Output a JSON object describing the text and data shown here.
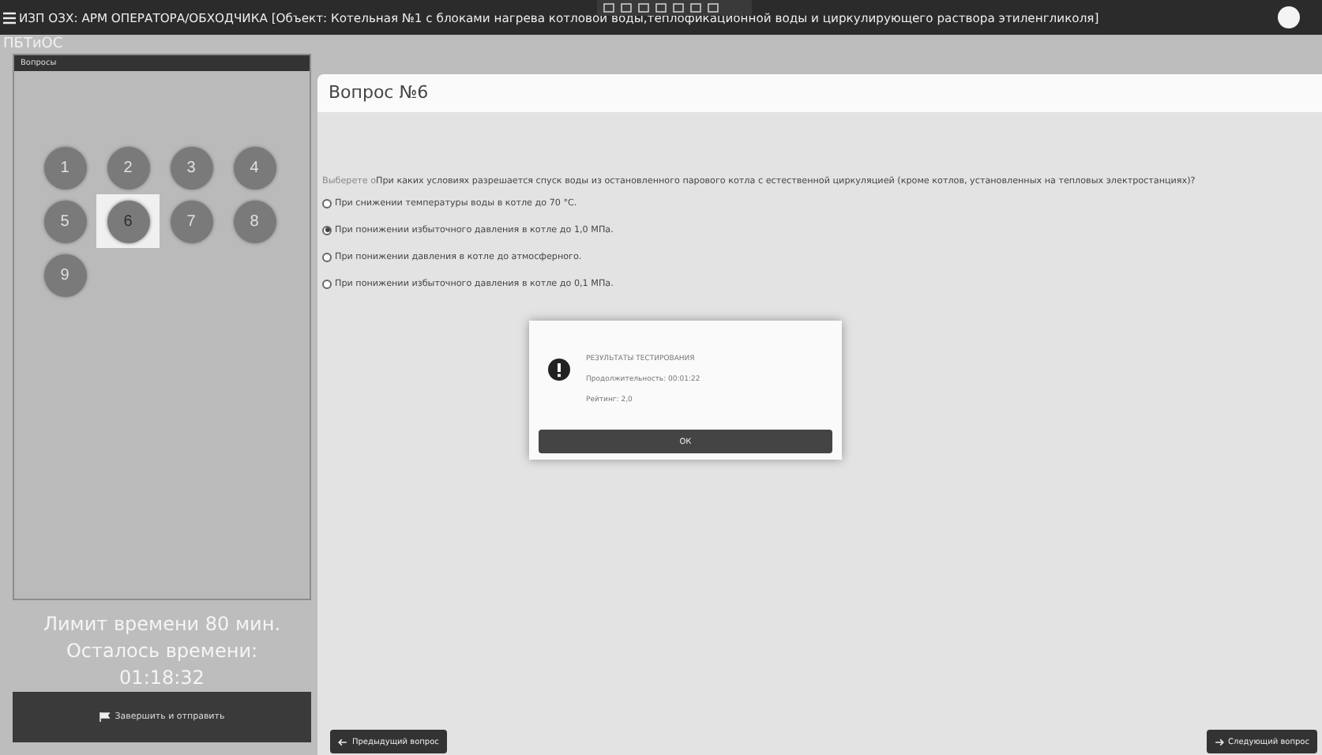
{
  "window": {
    "title": "ИЗП ОЗХ: АРМ ОПЕРАТОРА/ОБХОДЧИКА [Объект: Котельная №1 с блоками нагрева котловой воды,теплофикационной воды и циркулирующего раствора этиленгликоля]"
  },
  "breadcrumb": "ПБТиОС",
  "sidebar": {
    "title": "Вопросы",
    "questions": [
      {
        "label": "1",
        "selected": false
      },
      {
        "label": "2",
        "selected": false
      },
      {
        "label": "3",
        "selected": false
      },
      {
        "label": "4",
        "selected": false
      },
      {
        "label": "5",
        "selected": false
      },
      {
        "label": "6",
        "selected": true
      },
      {
        "label": "7",
        "selected": false
      },
      {
        "label": "8",
        "selected": false
      },
      {
        "label": "9",
        "selected": false
      }
    ],
    "timer": [
      "Лимит времени 80 мин.",
      "Осталось времени:",
      "01:18:32"
    ],
    "finish_button": "Завершить и отправить"
  },
  "question": {
    "title": "Вопрос №6",
    "prompt": "Выберете о",
    "text": "При каких условиях разрешается спуск воды из остановленного парового котла с естественной циркуляцией (кроме котлов, установленных на тепловых электростанциях)?",
    "options": [
      {
        "label": "При снижении температуры воды в котле до 70 °С.",
        "selected": false
      },
      {
        "label": "При понижении избыточного давления в котле до 1,0 МПа.",
        "selected": true
      },
      {
        "label": "При понижении давления в котле до атмосферного.",
        "selected": false
      },
      {
        "label": "При понижении избыточного давления в котле до 0,1 МПа.",
        "selected": false
      }
    ]
  },
  "dialog": {
    "title": "РЕЗУЛЬТАТЫ ТЕСТИРОВАНИЯ",
    "duration": "Продолжительность: 00:01:22",
    "rating": "Рейтинг: 2,0",
    "ok": "ОК"
  },
  "nav": {
    "prev": "Предыдущий вопрос",
    "next": "Следующий вопрос"
  }
}
